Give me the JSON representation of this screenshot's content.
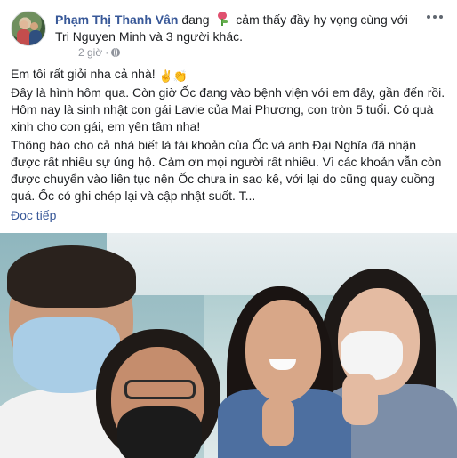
{
  "header": {
    "author": "Phạm Thị Thanh Vân",
    "status_pre": "đang",
    "status_post": "cảm thấy đầy hy vọng cùng với",
    "tagged": "Tri Nguyen Minh và 3 người khác.",
    "time": "2 giờ",
    "privacy_icon": "globe-icon",
    "more_icon": "more-options-icon",
    "feeling_icon": "tulip-icon"
  },
  "body": {
    "line1": "Em tôi rất giỏi nha cả nhà!",
    "line1_emoji": "✌👏",
    "para2": "Đây là hình hôm qua. Còn giờ Ốc đang vào bệnh viện với em đây, gần đến rồi. Hôm nay là sinh nhật con gái Lavie của Mai Phương, con tròn 5 tuổi. Có quà xinh cho con gái, em yên tâm nha!",
    "para3": "Thông báo cho cả nhà biết là tài khoản của Ốc và anh Đại Nghĩa đã nhận được rất nhiều sự ủng hộ. Cảm ơn mọi người rất nhiều. Vì các khoản vẫn còn được chuyển vào liên tục nên Ốc chưa in sao kê, với lại do cũng quay cuồng quá. Ốc có ghi chép lại và cập nhật suốt. T...",
    "read_more": "Đọc tiếp"
  },
  "colors": {
    "link": "#385898",
    "text": "#1c1e21",
    "meta": "#90949c"
  }
}
